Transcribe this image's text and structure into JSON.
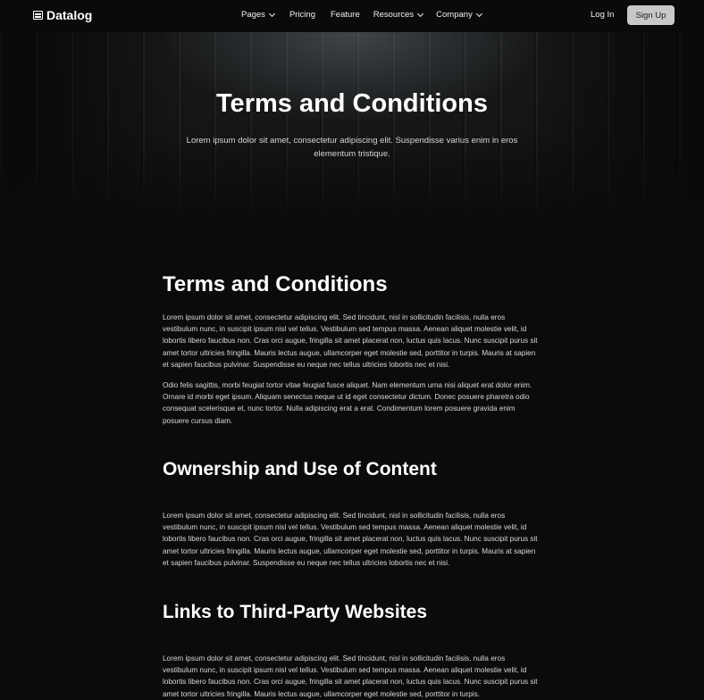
{
  "nav": {
    "brand": "Datalog",
    "links": [
      "Pages",
      "Pricing",
      "Feature",
      "Resources",
      "Company"
    ],
    "login": "Log In",
    "signup": "Sign Up"
  },
  "hero": {
    "title": "Terms and Conditions",
    "subtitle_line1": "Lorem ipsum dolor sit amet, consectetur adipiscing elit. Suspendisse varius enim in eros",
    "subtitle_line2": "elementum tristique."
  },
  "sections": [
    {
      "heading": "Terms and Conditions",
      "paragraphs": [
        "Lorem ipsum dolor sit amet, consectetur adipiscing elit. Sed tincidunt, nisl in sollicitudin facilisis, nulla eros vestibulum nunc, in suscipit ipsum nisl vel tellus. Vestibulum sed tempus massa. Aenean aliquet molestie velit, id lobortis libero faucibus non. Cras orci augue, fringilla sit amet placerat non, luctus quis lacus. Nunc suscipit purus sit amet tortor ultricies fringilla. Mauris lectus augue, ullamcorper eget molestie sed, porttitor in turpis. Mauris at sapien et sapien faucibus pulvinar. Suspendisse eu neque nec tellus ultricies lobortis nec et nisi.",
        "Odio felis sagittis, morbi feugiat tortor vitae feugiat fusce aliquet. Nam elementum urna nisi aliquet erat dolor enim. Ornare id morbi eget ipsum. Aliquam senectus neque ut id eget consectetur dictum. Donec posuere pharetra odio consequat scelerisque et, nunc tortor. Nulla adipiscing erat a erat. Condimentum lorem posuere gravida enim posuere cursus diam."
      ]
    },
    {
      "heading": "Ownership and Use of Content",
      "paragraphs": [
        "Lorem ipsum dolor sit amet, consectetur adipiscing elit. Sed tincidunt, nisl in sollicitudin facilisis, nulla eros vestibulum nunc, in suscipit ipsum nisl vel tellus. Vestibulum sed tempus massa. Aenean aliquet molestie velit, id lobortis libero faucibus non. Cras orci augue, fringilla sit amet placerat non, luctus quis lacus. Nunc suscipit purus sit amet tortor ultricies fringilla. Mauris lectus augue, ullamcorper eget molestie sed, porttitor in turpis. Mauris at sapien et sapien faucibus pulvinar. Suspendisse eu neque nec tellus ultricies lobortis nec et nisi."
      ]
    },
    {
      "heading": "Links to Third-Party Websites",
      "paragraphs": [
        "Lorem ipsum dolor sit amet, consectetur adipiscing elit. Sed tincidunt, nisl in sollicitudin facilisis, nulla eros vestibulum nunc, in suscipit ipsum nisl vel tellus. Vestibulum sed tempus massa. Aenean aliquet molestie velit, id lobortis libero faucibus non. Cras orci augue, fringilla sit amet placerat non, luctus quis lacus. Nunc suscipit purus sit amet tortor ultricies fringilla. Mauris lectus augue, ullamcorper eget molestie sed, porttitor in turpis."
      ]
    }
  ]
}
